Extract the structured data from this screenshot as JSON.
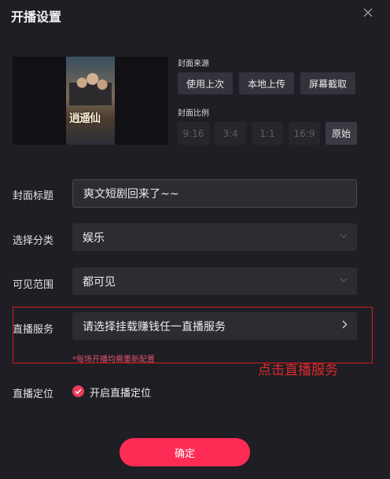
{
  "dialog": {
    "title": "开播设置"
  },
  "cover": {
    "poster_text": "逍遥仙",
    "source_label": "封面来源",
    "source_buttons": [
      "使用上次",
      "本地上传",
      "屏幕截取"
    ],
    "ratio_label": "封面比例",
    "ratios": [
      "9:16",
      "3:4",
      "1:1",
      "16:9",
      "原始"
    ],
    "selected_ratio": "原始"
  },
  "form": {
    "title_label": "封面标题",
    "title_value": "爽文短剧回来了~~",
    "category_label": "选择分类",
    "category_value": "娱乐",
    "visibility_label": "可见范围",
    "visibility_value": "都可见",
    "service_label": "直播服务",
    "service_placeholder": "请选择挂载赚钱任一直播服务",
    "service_hint": "*每场开播均需重新配置",
    "location_label": "直播定位",
    "location_option": "开启直播定位",
    "location_enabled": true
  },
  "annotation": {
    "text": "点击直播服务",
    "color": "#dd2a2a"
  },
  "actions": {
    "confirm_label": "确定"
  },
  "colors": {
    "accent": "#fe2c55",
    "background": "#1e1e24",
    "field": "#2c2c33"
  }
}
